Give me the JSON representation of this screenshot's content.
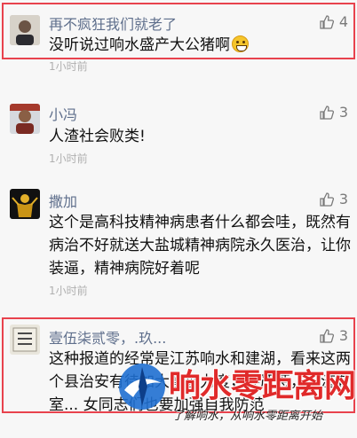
{
  "comments": [
    {
      "name": "再不疯狂我们就老了",
      "likes": "4",
      "text": "没听说过响水盛产大公猪啊",
      "emoji": "grinning-face",
      "time": "1小时前"
    },
    {
      "name": "小冯",
      "likes": "3",
      "text": "人渣社会败类!",
      "time": "1小时前"
    },
    {
      "name": "撒加",
      "likes": "3",
      "text": "这个是高科技精神病患者什么都会哇，既然有病治不好就送大盐城精神病院永久医治，让你装逼，精神病院好着呢",
      "time": "1小时前"
    },
    {
      "name": "壹伍柒贰零，.玖...",
      "likes": "3",
      "text": "这种报道的经常是江苏响水和建湖，看来这两个县治安有待加大管理力度，要严惩，人渣有室... 女同志们也要加强自我防范"
    }
  ],
  "watermark": {
    "title": "响水零距离网",
    "subtitle": "了解响水，从响水零距离开始"
  },
  "colors": {
    "highlight": "#e8424d",
    "name": "#5f6f8c",
    "watermark": "#e02a2a"
  }
}
